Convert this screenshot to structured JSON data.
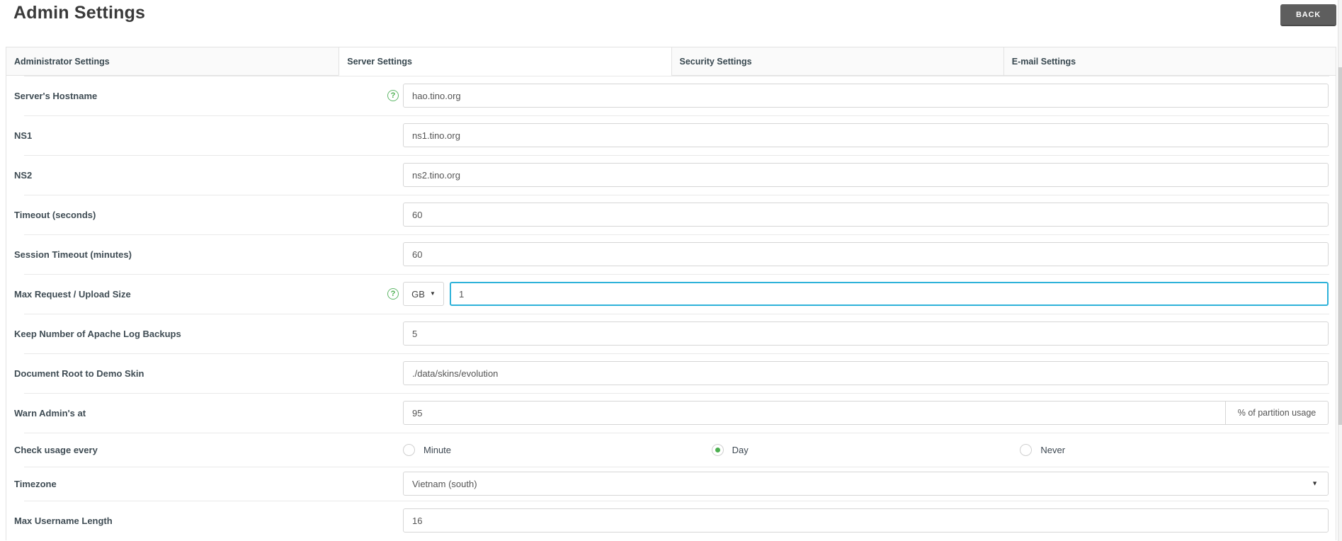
{
  "page": {
    "title": "Admin Settings"
  },
  "toolbar": {
    "back_label": "BACK"
  },
  "tabs": [
    {
      "label": "Administrator Settings",
      "active": false
    },
    {
      "label": "Server Settings",
      "active": true
    },
    {
      "label": "Security Settings",
      "active": false
    },
    {
      "label": "E-mail Settings",
      "active": false
    }
  ],
  "icons": {
    "help": "?",
    "caret_down": "▼"
  },
  "colors": {
    "accent_green": "#4caf50",
    "focus_blue": "#2eb2d9",
    "back_button_gray": "#5e5e5e"
  },
  "rows": [
    {
      "label": "Server's Hostname",
      "value": "hao.tino.org",
      "has_help": true
    },
    {
      "label": "NS1",
      "value": "ns1.tino.org"
    },
    {
      "label": "NS2",
      "value": "ns2.tino.org"
    },
    {
      "label": "Timeout (seconds)",
      "value": "60"
    },
    {
      "label": "Session Timeout (minutes)",
      "value": "60"
    },
    {
      "label": "Max Request / Upload Size",
      "unit": "GB",
      "value": "1",
      "has_help": true,
      "focused": true
    },
    {
      "label": "Keep Number of Apache Log Backups",
      "value": "5"
    },
    {
      "label": "Document Root to Demo Skin",
      "value": "./data/skins/evolution"
    },
    {
      "label": "Warn Admin's at",
      "value": "95",
      "addon": "% of partition usage"
    },
    {
      "label": "Check usage every",
      "options": [
        "Minute",
        "Day",
        "Never"
      ],
      "selected": "Day"
    },
    {
      "label": "Timezone",
      "value": "Vietnam (south)"
    },
    {
      "label": "Max Username Length",
      "value": "16"
    }
  ]
}
